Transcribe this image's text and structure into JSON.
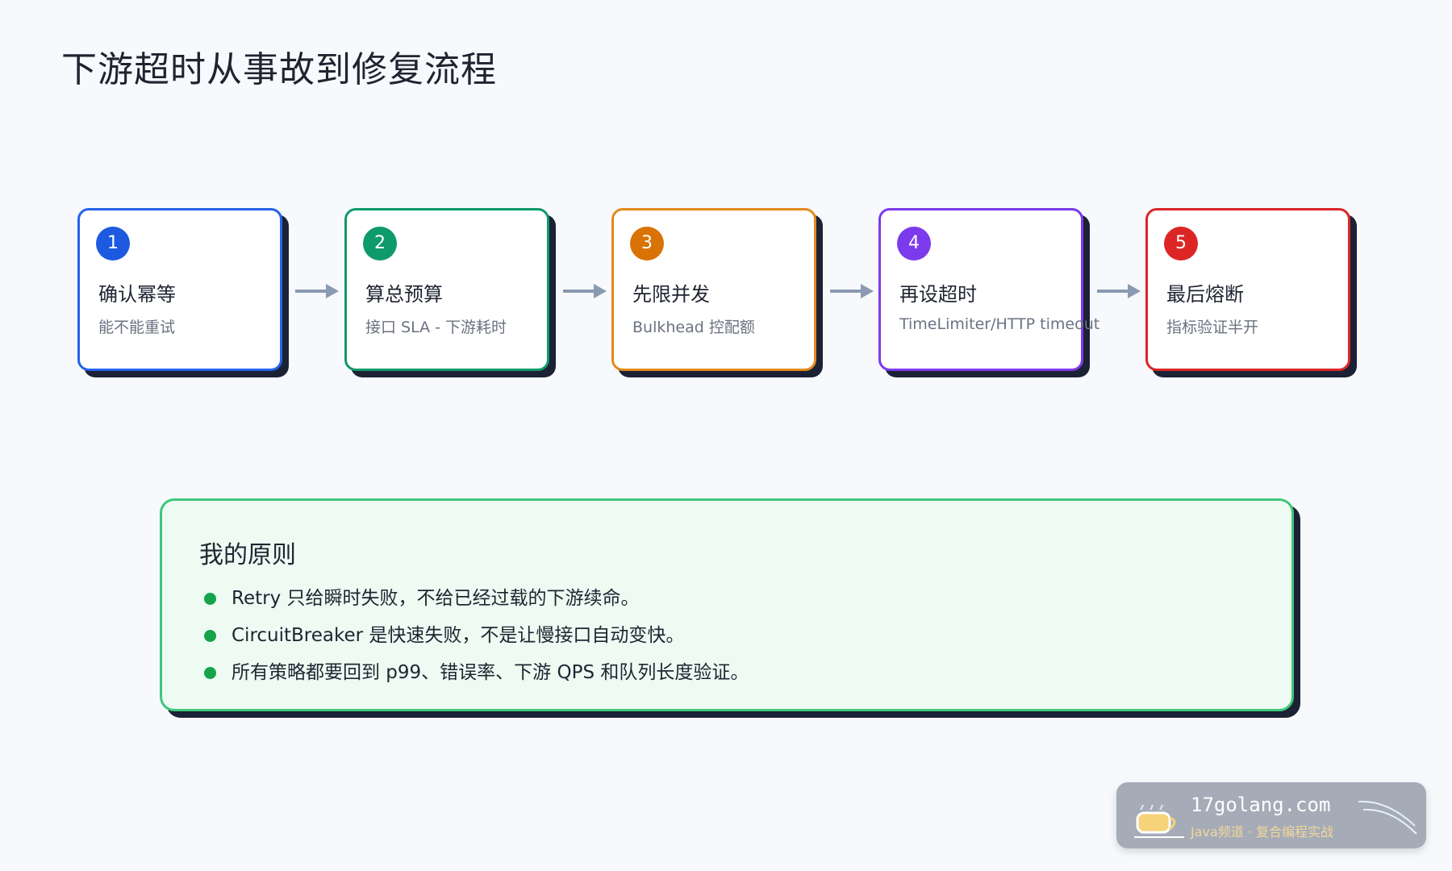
{
  "page": {
    "title": "下游超时从事故到修复流程"
  },
  "steps": [
    {
      "num": "1",
      "title": "确认幂等",
      "subtitle": "能不能重试",
      "color": "#2563eb",
      "circle": "#1d5ae0"
    },
    {
      "num": "2",
      "title": "算总预算",
      "subtitle": "接口 SLA - 下游耗时",
      "color": "#0f9a6a",
      "circle": "#0f9a6a"
    },
    {
      "num": "3",
      "title": "先限并发",
      "subtitle": "Bulkhead 控配额",
      "color": "#e38a1c",
      "circle": "#d97306"
    },
    {
      "num": "4",
      "title": "再设超时",
      "subtitle": "TimeLimiter/HTTP timeout",
      "color": "#7c3aed",
      "circle": "#7c3aed"
    },
    {
      "num": "5",
      "title": "最后熔断",
      "subtitle": "指标验证半开",
      "color": "#dc2626",
      "circle": "#dc2626"
    }
  ],
  "arrow_color": "#8a9ab0",
  "principles": {
    "heading": "我的原则",
    "items": [
      "Retry 只给瞬时失败，不给已经过载的下游续命。",
      "CircuitBreaker 是快速失败，不是让慢接口自动变快。",
      "所有策略都要回到 p99、错误率、下游 QPS 和队列长度验证。"
    ],
    "bullet_color": "#16a34a",
    "border_color": "#3ec77a"
  },
  "watermark": {
    "domain": "17golang.com",
    "tagline": "Java频道 · 复合编程实战"
  }
}
